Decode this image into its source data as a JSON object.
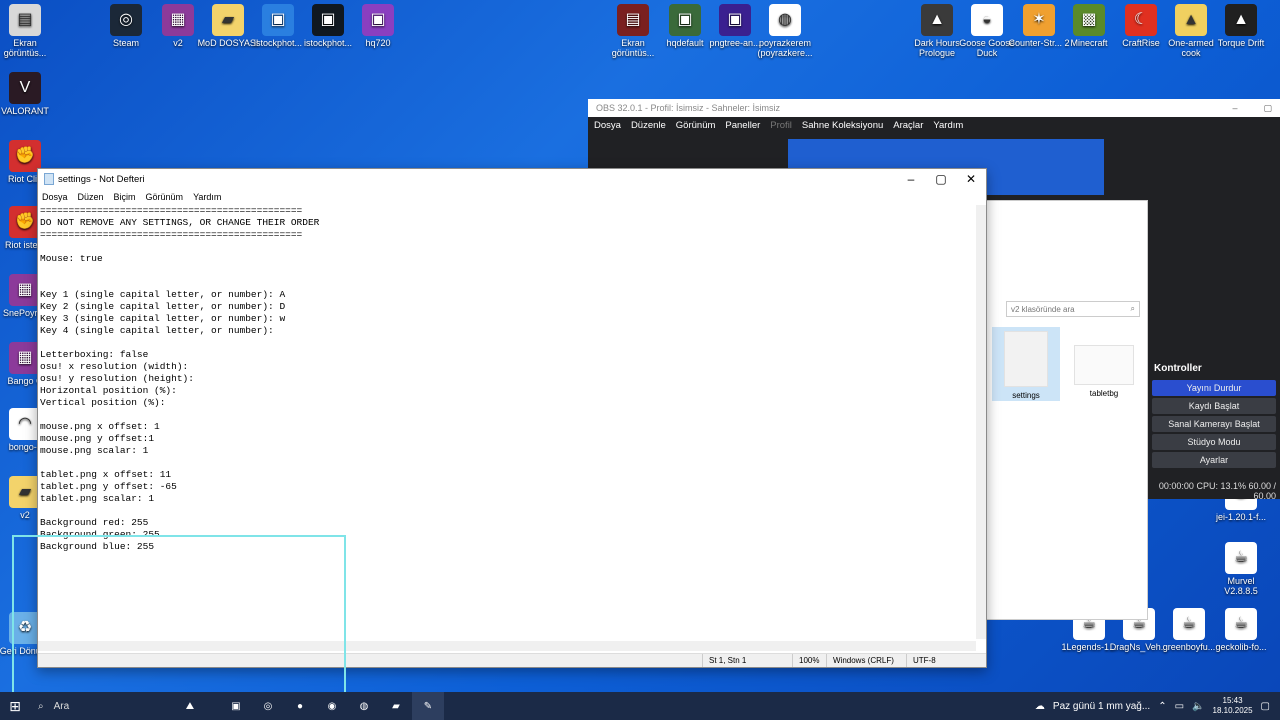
{
  "desktop": {
    "icons": [
      {
        "label": "Ekran görüntüs...",
        "icon": "screenshot-icon",
        "color": "#d8d8d8"
      },
      {
        "label": "Steam",
        "icon": "steam-icon",
        "color": "#1b2838"
      },
      {
        "label": "v2",
        "icon": "winrar-icon",
        "color": "#8c3a9a"
      },
      {
        "label": "MoD DOSYASI",
        "icon": "folder-icon",
        "color": "#f3d36b"
      },
      {
        "label": "istockphot...",
        "icon": "image-icon",
        "color": "#2a7fe0"
      },
      {
        "label": "istockphot...",
        "icon": "image-icon",
        "color": "#101820"
      },
      {
        "label": "hq720",
        "icon": "image-icon",
        "color": "#8a3fc0"
      },
      {
        "label": "VALORANT",
        "icon": "valorant-icon",
        "color": "#2a1a24"
      },
      {
        "label": "Riot Clie",
        "icon": "riot-icon",
        "color": "#d32f2f"
      },
      {
        "label": "Riot istem",
        "icon": "riot-icon",
        "color": "#d32f2f"
      },
      {
        "label": "SnePoyraz",
        "icon": "winrar-icon",
        "color": "#8c3a9a"
      },
      {
        "label": "Bango C",
        "icon": "winrar-icon",
        "color": "#8c3a9a"
      },
      {
        "label": "bongo-c",
        "icon": "bongo-cat-icon",
        "color": "#ffffff"
      },
      {
        "label": "v2",
        "icon": "folder-icon",
        "color": "#f3d36b"
      },
      {
        "label": "Geri Dönüşü",
        "icon": "recycle-bin-icon",
        "color": "#6ab0e8"
      },
      {
        "label": "Ekran görüntüs...",
        "icon": "screenshot-icon",
        "color": "#7a2020"
      },
      {
        "label": "hqdefault",
        "icon": "image-icon",
        "color": "#3a6a3a"
      },
      {
        "label": "pngtree-an...",
        "icon": "image-icon",
        "color": "#3a2090"
      },
      {
        "label": "poyrazkerem (poyrazkere...",
        "icon": "chrome-icon",
        "color": "#ffffff"
      },
      {
        "label": "Dark Hours Prologue",
        "icon": "game-icon",
        "color": "#3a3a3a"
      },
      {
        "label": "Goose Goose Duck",
        "icon": "goose-icon",
        "color": "#ffffff"
      },
      {
        "label": "Counter-Str... 2",
        "icon": "cs2-icon",
        "color": "#f0a030"
      },
      {
        "label": "Minecraft",
        "icon": "minecraft-icon",
        "color": "#5a8a2a"
      },
      {
        "label": "CraftRise",
        "icon": "craftrise-icon",
        "color": "#e03020"
      },
      {
        "label": "One-armed cook",
        "icon": "game-icon",
        "color": "#f0d060"
      },
      {
        "label": "Torque Drift",
        "icon": "game-icon",
        "color": "#202020"
      },
      {
        "label": "jei-1.20.1-f...",
        "icon": "java-icon",
        "color": "#ffffff"
      },
      {
        "label": "Murvel V2.8.8.5",
        "icon": "java-icon",
        "color": "#ffffff"
      },
      {
        "label": "1Legends-1...",
        "icon": "java-icon",
        "color": "#ffffff"
      },
      {
        "label": "DragNs_Veh...",
        "icon": "java-icon",
        "color": "#ffffff"
      },
      {
        "label": "greenboyfu...",
        "icon": "java-icon",
        "color": "#ffffff"
      },
      {
        "label": "geckolib-fo...",
        "icon": "java-icon",
        "color": "#ffffff"
      }
    ]
  },
  "obs": {
    "title": "OBS 32.0.1 - Profil: İsimsiz - Sahneler: İsimsiz",
    "menu": [
      "Dosya",
      "Düzenle",
      "Görünüm",
      "Paneller",
      "Profil",
      "Sahne Koleksiyonu",
      "Araçlar",
      "Yardım"
    ],
    "controls_title": "Kontroller",
    "controls": [
      "Yayını Durdur",
      "Kaydı Başlat",
      "Sanal Kamerayı Başlat",
      "Stüdyo Modu",
      "Ayarlar"
    ],
    "status": "00:00:00  CPU: 13.1% 60.00 / 60.00"
  },
  "explorer": {
    "search_placeholder": "v2 klasöründe ara",
    "files": [
      "settings",
      "tabletbg"
    ]
  },
  "notepad": {
    "title": "settings - Not Defteri",
    "menu": [
      "Dosya",
      "Düzen",
      "Biçim",
      "Görünüm",
      "Yardım"
    ],
    "content": "==============================================\nDO NOT REMOVE ANY SETTINGS, OR CHANGE THEIR ORDER\n==============================================\n\nMouse: true\n\n\nKey 1 (single capital letter, or number): A\nKey 2 (single capital letter, or number): D\nKey 3 (single capital letter, or number): w\nKey 4 (single capital letter, or number):\n\nLetterboxing: false\nosu! x resolution (width):\nosu! y resolution (height):\nHorizontal position (%):\nVertical position (%):\n\nmouse.png x offset: 1\nmouse.png y offset:1\nmouse.png scalar: 1\n\ntablet.png x offset: 11\ntablet.png y offset: -65\ntablet.png scalar: 1\n\nBackground red: 255\nBackground green: 255\nBackground blue: 255",
    "status": {
      "position": "St 1, Stn 1",
      "zoom": "100%",
      "line_ending": "Windows (CRLF)",
      "encoding": "UTF-8"
    }
  },
  "taskbar": {
    "search_label": "Ara",
    "weather": "Paz günü 1 mm yağ...",
    "time": "15:43",
    "date": "18.10.2025"
  }
}
